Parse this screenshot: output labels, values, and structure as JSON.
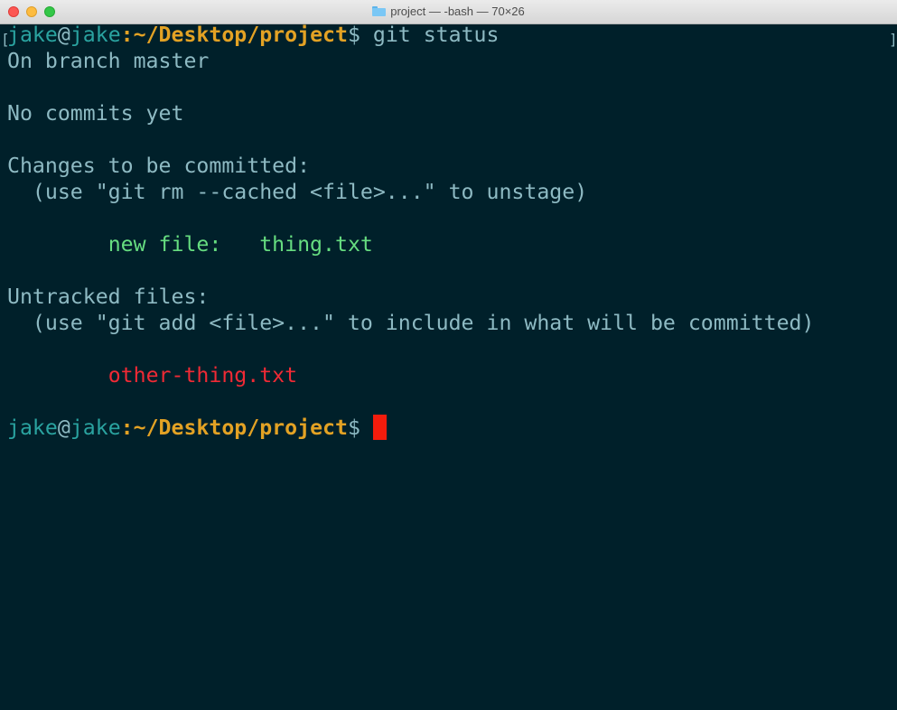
{
  "window": {
    "title": "project — -bash — 70×26",
    "title_icon": "folder-icon"
  },
  "colors": {
    "terminal_background": "#00202a",
    "default_text": "#8ebac3",
    "user": "#2aa3a0",
    "path": "#e3a224",
    "staged": "#66dd80",
    "untracked": "#f02a35",
    "cursor": "#f41c0c"
  },
  "terminal": {
    "prompt": {
      "user": "jake",
      "at": "@",
      "host": "jake",
      "colon": ":",
      "path": "~/Desktop/project",
      "symbol": "$"
    },
    "command": " git status",
    "output": {
      "branch": "On branch master",
      "no_commits": "No commits yet",
      "staged_header": "Changes to be committed:",
      "staged_hint": "  (use \"git rm --cached <file>...\" to unstage)",
      "staged_prefix": "        ",
      "staged_entry_status": "new file:   ",
      "staged_entry_file": "thing.txt",
      "untracked_header": "Untracked files:",
      "untracked_hint": "  (use \"git add <file>...\" to include in what will be committed)",
      "untracked_prefix": "        ",
      "untracked_file": "other-thing.txt"
    }
  }
}
